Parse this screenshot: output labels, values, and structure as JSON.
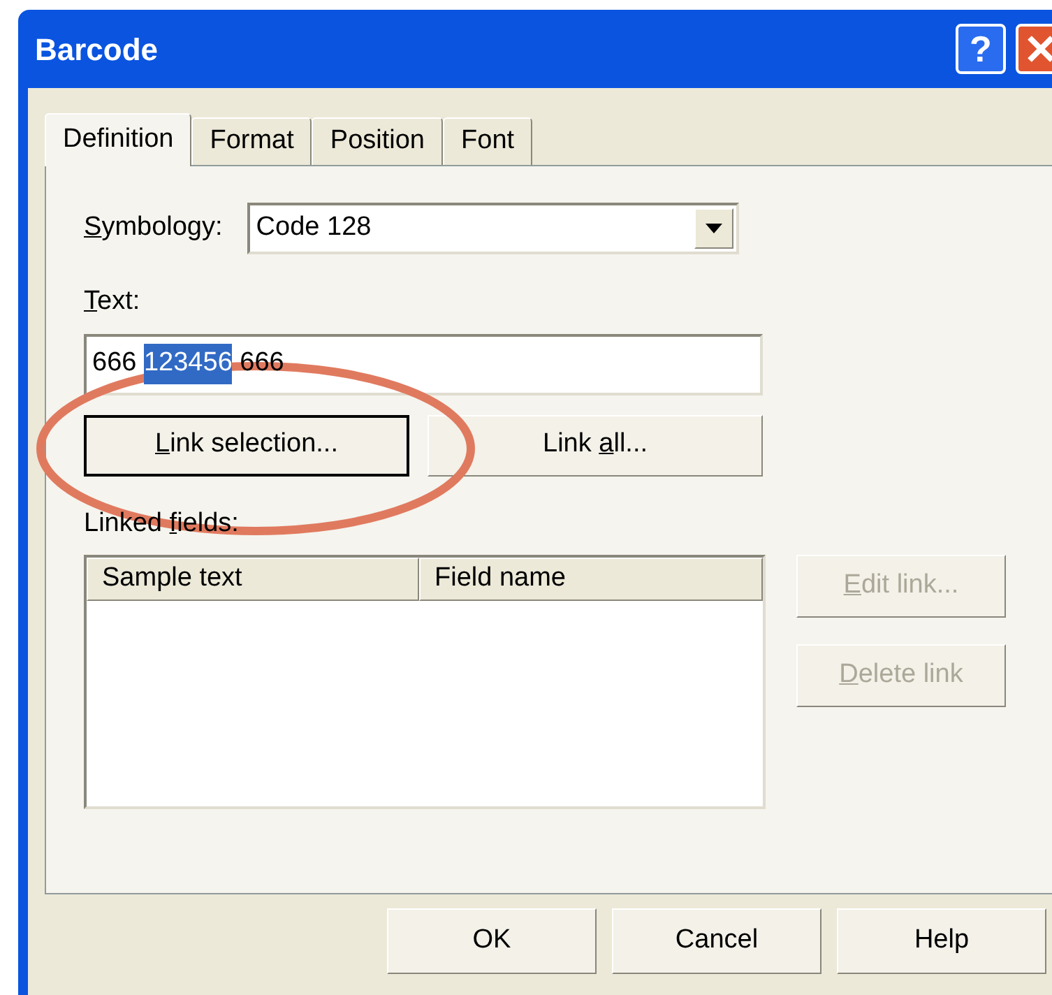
{
  "window": {
    "title": "Barcode",
    "title_buttons": [
      {
        "kind": "help",
        "label": "?"
      },
      {
        "kind": "close"
      }
    ]
  },
  "tabs": [
    {
      "label": "Definition",
      "selected": true
    },
    {
      "label": "Format",
      "selected": false
    },
    {
      "label": "Position",
      "selected": false
    },
    {
      "label": "Font",
      "selected": false
    }
  ],
  "symbology": {
    "label_parts": [
      {
        "t": "S",
        "u": true
      },
      {
        "t": "ymbology:",
        "u": false
      }
    ],
    "value": "Code 128"
  },
  "text": {
    "label_parts": [
      {
        "t": "T",
        "u": true
      },
      {
        "t": "ext:",
        "u": false
      }
    ],
    "value_parts": [
      {
        "t": "666 ",
        "selected": false
      },
      {
        "t": "123456",
        "selected": true
      },
      {
        "t": " 666",
        "selected": false
      }
    ]
  },
  "link_buttons": [
    {
      "parts": [
        {
          "t": "L",
          "u": true
        },
        {
          "t": "ink selection...",
          "u": false
        }
      ],
      "focused": true,
      "disabled": false
    },
    {
      "parts": [
        {
          "t": "Link ",
          "u": false
        },
        {
          "t": "a",
          "u": true
        },
        {
          "t": "ll...",
          "u": false
        }
      ],
      "focused": false,
      "disabled": false
    }
  ],
  "linked_fields": {
    "label_parts": [
      {
        "t": "Linked ",
        "u": false
      },
      {
        "t": "f",
        "u": true
      },
      {
        "t": "ields:",
        "u": false
      }
    ],
    "columns": [
      "Sample text",
      "Field name"
    ]
  },
  "side_buttons": [
    {
      "parts": [
        {
          "t": "E",
          "u": true
        },
        {
          "t": "dit link...",
          "u": false
        }
      ],
      "disabled": true
    },
    {
      "parts": [
        {
          "t": "D",
          "u": true
        },
        {
          "t": "elete link",
          "u": false
        }
      ],
      "disabled": true
    }
  ],
  "annotation": {
    "kind": "ellipse",
    "color": "#e07a5f"
  },
  "buttons": [
    "OK",
    "Cancel",
    "Help"
  ]
}
